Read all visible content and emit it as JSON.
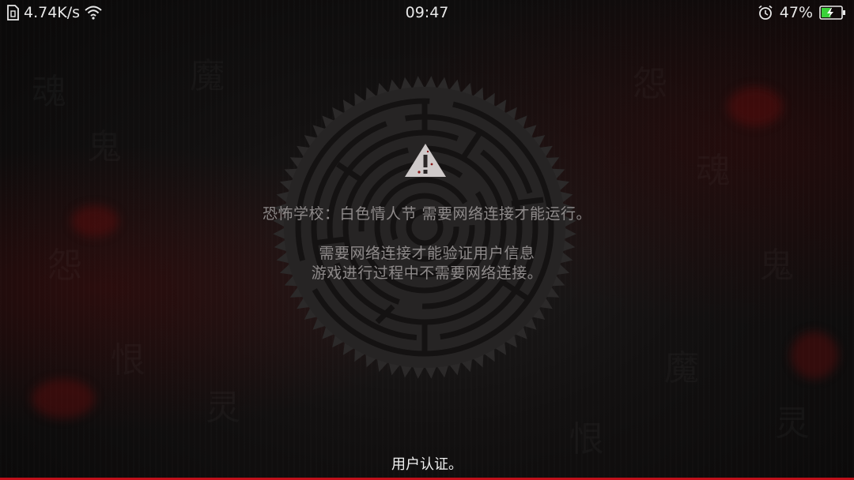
{
  "status_bar": {
    "network_speed": "4.74K/s",
    "time": "09:47",
    "battery_percent": "47%",
    "battery_level": 0.47,
    "icons": [
      "sim-icon",
      "wifi-icon",
      "alarm-icon",
      "battery-charging-icon"
    ]
  },
  "dialog": {
    "icon": "warning-icon",
    "title": "恐怖学校：白色情人节 需要网络连接才能运行。",
    "line1": "需要网络连接才能验证用户信息",
    "line2": "游戏进行过程中不需要网络连接。"
  },
  "footer": {
    "label": "用户认证。"
  },
  "colors": {
    "accent_line": "#c0101a",
    "battery_fill": "#3ad23a",
    "message_text": "#8e8a8a"
  }
}
